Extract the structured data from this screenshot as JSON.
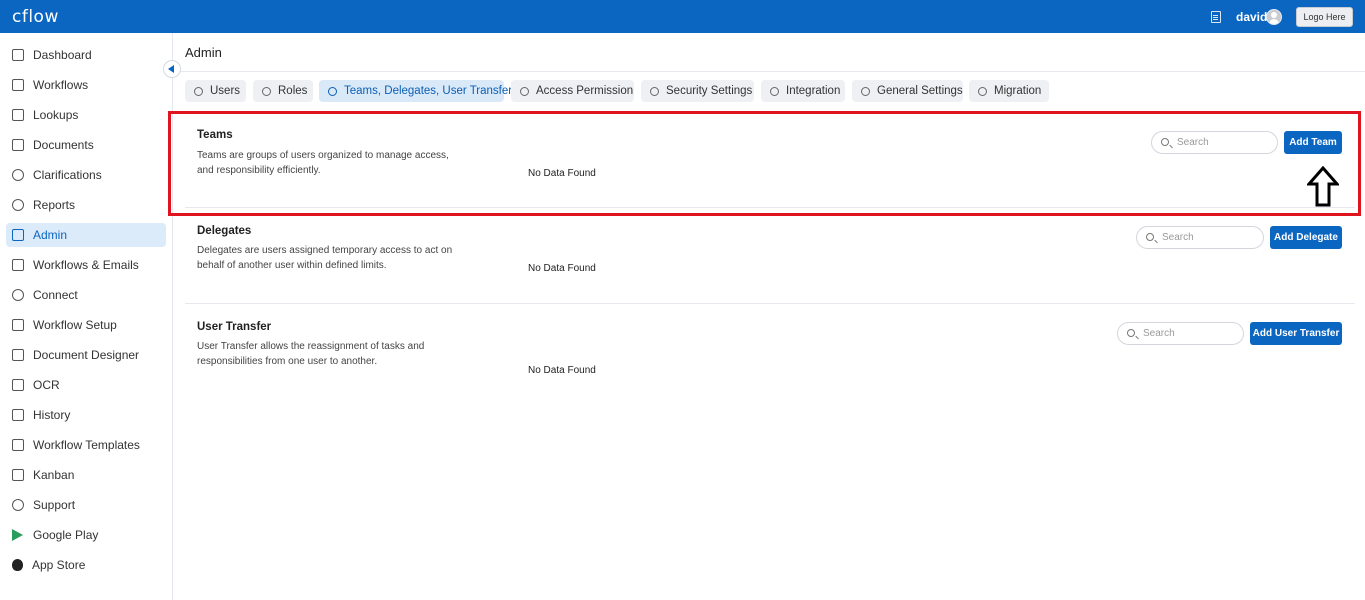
{
  "header": {
    "logo_text": "cflow",
    "username": "david",
    "logo_placeholder": "Logo Here"
  },
  "sidebar": {
    "items": [
      {
        "label": "Dashboard",
        "icon": "grid-icon"
      },
      {
        "label": "Workflows",
        "icon": "workflow-icon"
      },
      {
        "label": "Lookups",
        "icon": "table-icon"
      },
      {
        "label": "Documents",
        "icon": "document-icon"
      },
      {
        "label": "Clarifications",
        "icon": "lightbulb-icon"
      },
      {
        "label": "Reports",
        "icon": "pie-chart-icon"
      },
      {
        "label": "Admin",
        "icon": "admin-icon",
        "active": true
      },
      {
        "label": "Workflows & Emails",
        "icon": "mail-icon"
      },
      {
        "label": "Connect",
        "icon": "connect-icon"
      },
      {
        "label": "Workflow Setup",
        "icon": "sliders-icon"
      },
      {
        "label": "Document Designer",
        "icon": "pen-document-icon"
      },
      {
        "label": "OCR",
        "icon": "scan-icon"
      },
      {
        "label": "History",
        "icon": "history-icon"
      },
      {
        "label": "Workflow Templates",
        "icon": "template-icon"
      },
      {
        "label": "Kanban",
        "icon": "kanban-icon"
      },
      {
        "label": "Support",
        "icon": "support-icon"
      },
      {
        "label": "Google Play",
        "icon": "google-play-icon"
      },
      {
        "label": "App Store",
        "icon": "apple-icon"
      }
    ]
  },
  "page": {
    "title": "Admin"
  },
  "tabs": [
    {
      "label": "Users",
      "icon": "user-icon"
    },
    {
      "label": "Roles",
      "icon": "roles-icon"
    },
    {
      "label": "Teams, Delegates, User Transfer",
      "icon": "globe-icon",
      "active": true
    },
    {
      "label": "Access Permission",
      "icon": "key-icon"
    },
    {
      "label": "Security Settings",
      "icon": "lock-icon"
    },
    {
      "label": "Integration",
      "icon": "integration-icon"
    },
    {
      "label": "General Settings",
      "icon": "gear-icon"
    },
    {
      "label": "Migration",
      "icon": "migration-icon"
    }
  ],
  "sections": {
    "teams": {
      "title": "Teams",
      "description": "Teams are groups of users organized to manage access, and responsibility efficiently.",
      "empty_text": "No Data Found",
      "search_placeholder": "Search",
      "button_label": "Add Team"
    },
    "delegates": {
      "title": "Delegates",
      "description": "Delegates are users assigned temporary access to act on behalf of another user within defined limits.",
      "empty_text": "No Data Found",
      "search_placeholder": "Search",
      "button_label": "Add Delegate"
    },
    "user_transfer": {
      "title": "User Transfer",
      "description": "User Transfer allows the reassignment of tasks and responsibilities from one user to another.",
      "empty_text": "No Data Found",
      "search_placeholder": "Search",
      "button_label": "Add User Transfer"
    }
  },
  "colors": {
    "brand": "#0b66c2",
    "highlight": "#e0141e"
  }
}
